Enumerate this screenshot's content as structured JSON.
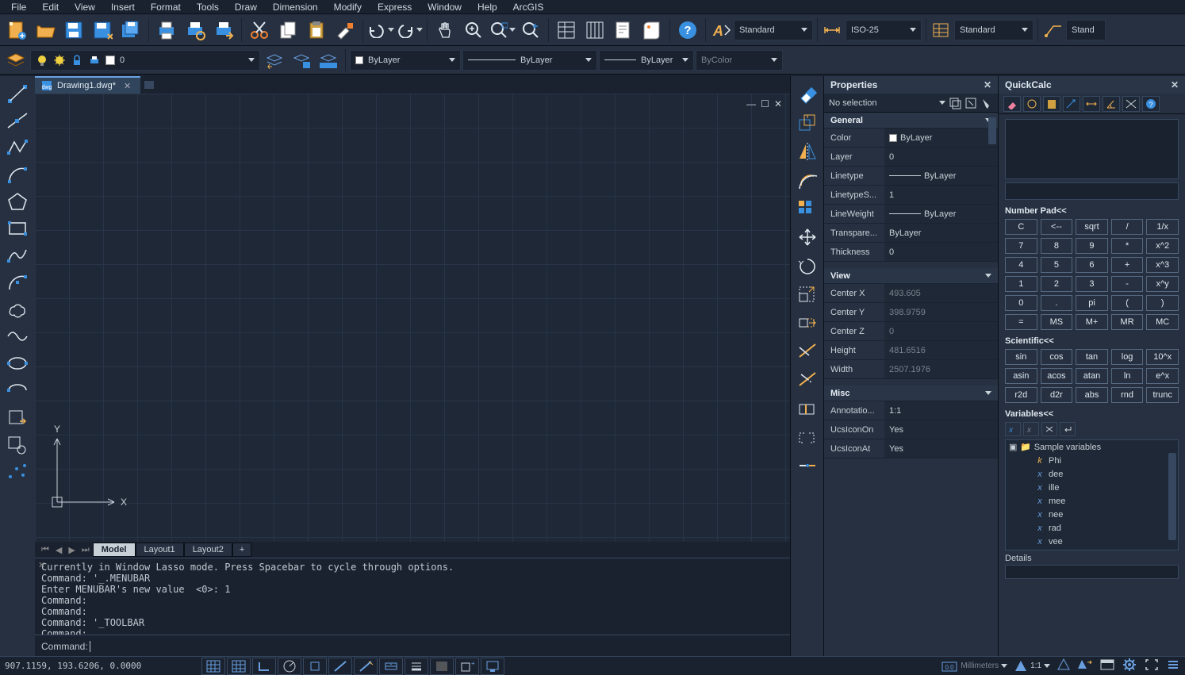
{
  "menubar": [
    "File",
    "Edit",
    "View",
    "Insert",
    "Format",
    "Tools",
    "Draw",
    "Dimension",
    "Modify",
    "Express",
    "Window",
    "Help",
    "ArcGIS"
  ],
  "toolbar1": {
    "text_style": "Standard",
    "dim_style": "ISO-25",
    "table_style": "Standard",
    "mleader_abbrev": "Stand"
  },
  "toolbar2": {
    "layer_current": "0",
    "color": "ByLayer",
    "linetype": "ByLayer",
    "lineweight": "ByLayer",
    "plotstyle": "ByColor"
  },
  "doc_tab": {
    "label": "Drawing1.dwg*"
  },
  "model_tabs": {
    "active": "Model",
    "others": [
      "Layout1",
      "Layout2"
    ]
  },
  "command": {
    "history": "Currently in Window Lasso mode. Press Spacebar to cycle through options.\nCommand: '_.MENUBAR\nEnter MENUBAR's new value  <0>: 1\nCommand:\nCommand:\nCommand: '_TOOLBAR\nCommand:",
    "prompt": "Command: "
  },
  "statusbar": {
    "coords": "907.1159, 193.6206, 0.0000",
    "units": "Millimeters",
    "scale": "1:1"
  },
  "properties": {
    "title": "Properties",
    "selection": "No selection",
    "general_label": "General",
    "view_label": "View",
    "misc_label": "Misc",
    "general": [
      {
        "k": "Color",
        "v": "ByLayer",
        "swatch": true
      },
      {
        "k": "Layer",
        "v": "0"
      },
      {
        "k": "Linetype",
        "v": "ByLayer",
        "line": true
      },
      {
        "k": "LinetypeS...",
        "v": "1"
      },
      {
        "k": "LineWeight",
        "v": "ByLayer",
        "line": true
      },
      {
        "k": "Transpare...",
        "v": "ByLayer"
      },
      {
        "k": "Thickness",
        "v": "0"
      }
    ],
    "view": [
      {
        "k": "Center X",
        "v": "493.605",
        "dim": true
      },
      {
        "k": "Center Y",
        "v": "398.9759",
        "dim": true
      },
      {
        "k": "Center Z",
        "v": "0",
        "dim": true
      },
      {
        "k": "Height",
        "v": "481.6516",
        "dim": true
      },
      {
        "k": "Width",
        "v": "2507.1976",
        "dim": true
      }
    ],
    "misc": [
      {
        "k": "Annotatio...",
        "v": "1:1"
      },
      {
        "k": "UcsIconOn",
        "v": "Yes"
      },
      {
        "k": "UcsIconAt",
        "v": "Yes"
      }
    ]
  },
  "quickcalc": {
    "title": "QuickCalc",
    "numpad_label": "Number Pad<<",
    "scientific_label": "Scientific<<",
    "variables_label": "Variables<<",
    "details_label": "Details",
    "numpad": [
      [
        "C",
        "<--",
        "sqrt",
        "/",
        "1/x"
      ],
      [
        "7",
        "8",
        "9",
        "*",
        "x^2"
      ],
      [
        "4",
        "5",
        "6",
        "+",
        "x^3"
      ],
      [
        "1",
        "2",
        "3",
        "-",
        "x^y"
      ],
      [
        "0",
        ".",
        "pi",
        "(",
        ")"
      ],
      [
        "=",
        "MS",
        "M+",
        "MR",
        "MC"
      ]
    ],
    "scientific": [
      [
        "sin",
        "cos",
        "tan",
        "log",
        "10^x"
      ],
      [
        "asin",
        "acos",
        "atan",
        "ln",
        "e^x"
      ],
      [
        "r2d",
        "d2r",
        "abs",
        "rnd",
        "trunc"
      ]
    ],
    "vars_root": "Sample variables",
    "vars": [
      {
        "icon": "k",
        "name": "Phi"
      },
      {
        "icon": "x",
        "name": "dee"
      },
      {
        "icon": "x",
        "name": "ille"
      },
      {
        "icon": "x",
        "name": "mee"
      },
      {
        "icon": "x",
        "name": "nee"
      },
      {
        "icon": "x",
        "name": "rad"
      },
      {
        "icon": "x",
        "name": "vee"
      }
    ]
  }
}
